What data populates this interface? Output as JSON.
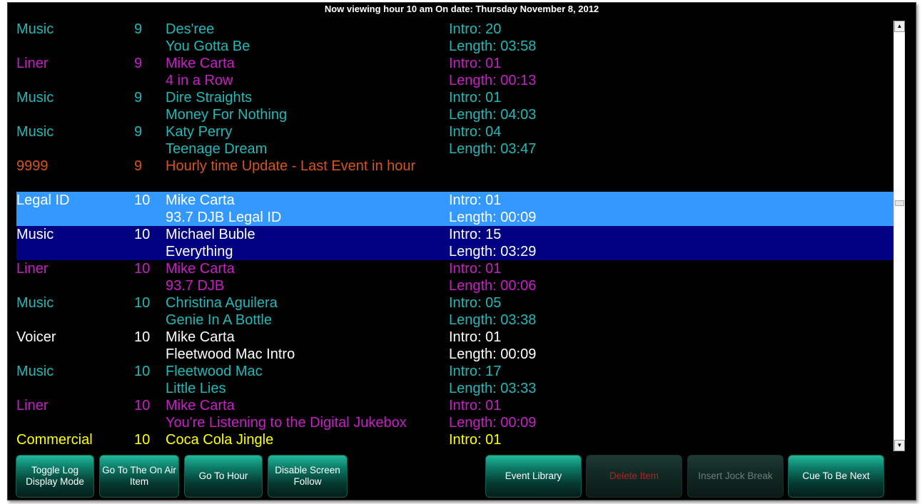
{
  "header": {
    "title": "Now viewing hour 10 am On date: Thursday November 8, 2012"
  },
  "log": [
    {
      "type": "Music",
      "hour": "9",
      "artist": "Des'ree",
      "title": "You Gotta Be",
      "intro": "Intro: 20",
      "length": "Length: 03:58"
    },
    {
      "type": "Liner",
      "hour": "9",
      "artist": "Mike Carta",
      "title": "4 in a Row",
      "intro": "Intro: 01",
      "length": "Length: 00:13"
    },
    {
      "type": "Music",
      "hour": "9",
      "artist": "Dire Straights",
      "title": "Money For Nothing",
      "intro": "Intro: 01",
      "length": "Length: 04:03"
    },
    {
      "type": "Music",
      "hour": "9",
      "artist": "Katy Perry",
      "title": "Teenage Dream",
      "intro": "Intro: 04",
      "length": "Length: 03:47"
    },
    {
      "type": "9999",
      "hour": "9",
      "artist": "Hourly time Update - Last Event in hour",
      "title": "",
      "intro": "",
      "length": ""
    },
    {
      "type": "Legal ID",
      "hour": "10",
      "artist": "Mike Carta",
      "title": "93.7 DJB Legal ID",
      "intro": "Intro: 01",
      "length": "Length: 00:09"
    },
    {
      "type": "Music",
      "hour": "10",
      "artist": "Michael Buble",
      "title": "Everything",
      "intro": "Intro: 15",
      "length": "Length: 03:29"
    },
    {
      "type": "Liner",
      "hour": "10",
      "artist": "Mike Carta",
      "title": "93.7 DJB",
      "intro": "Intro: 01",
      "length": "Length: 00:06"
    },
    {
      "type": "Music",
      "hour": "10",
      "artist": "Christina Aguilera",
      "title": "Genie In A Bottle",
      "intro": "Intro: 05",
      "length": "Length: 03:38"
    },
    {
      "type": "Voicer",
      "hour": "10",
      "artist": "Mike Carta",
      "title": "Fleetwood Mac Intro",
      "intro": "Intro: 01",
      "length": "Length: 00:09"
    },
    {
      "type": "Music",
      "hour": "10",
      "artist": "Fleetwood Mac",
      "title": "Little Lies",
      "intro": "Intro: 17",
      "length": "Length: 03:33"
    },
    {
      "type": "Liner",
      "hour": "10",
      "artist": "Mike Carta",
      "title": "You're Listening to the Digital Jukebox",
      "intro": "Intro: 01",
      "length": "Length: 00:09"
    },
    {
      "type": "Commercial",
      "hour": "10",
      "artist": "Coca Cola Jingle",
      "title": "",
      "intro": "Intro: 01",
      "length": ""
    }
  ],
  "buttons": {
    "toggle_log": "Toggle Log Display Mode",
    "go_on_air": "Go To The On Air Item",
    "go_hour": "Go To Hour",
    "disable_follow": "Disable Screen Follow",
    "event_library": "Event Library",
    "delete_item": "Delete Item",
    "insert_jock": "Insert Jock Break",
    "cue_next": "Cue To Be Next"
  },
  "colors": {
    "music": "#22b8b8",
    "liner": "#c81ec8",
    "top_of_hour": "#d9541b",
    "voicer": "#ffffff",
    "commercial": "#ffff00",
    "selected_light": "#3399ff",
    "selected_dark": "#000080"
  }
}
